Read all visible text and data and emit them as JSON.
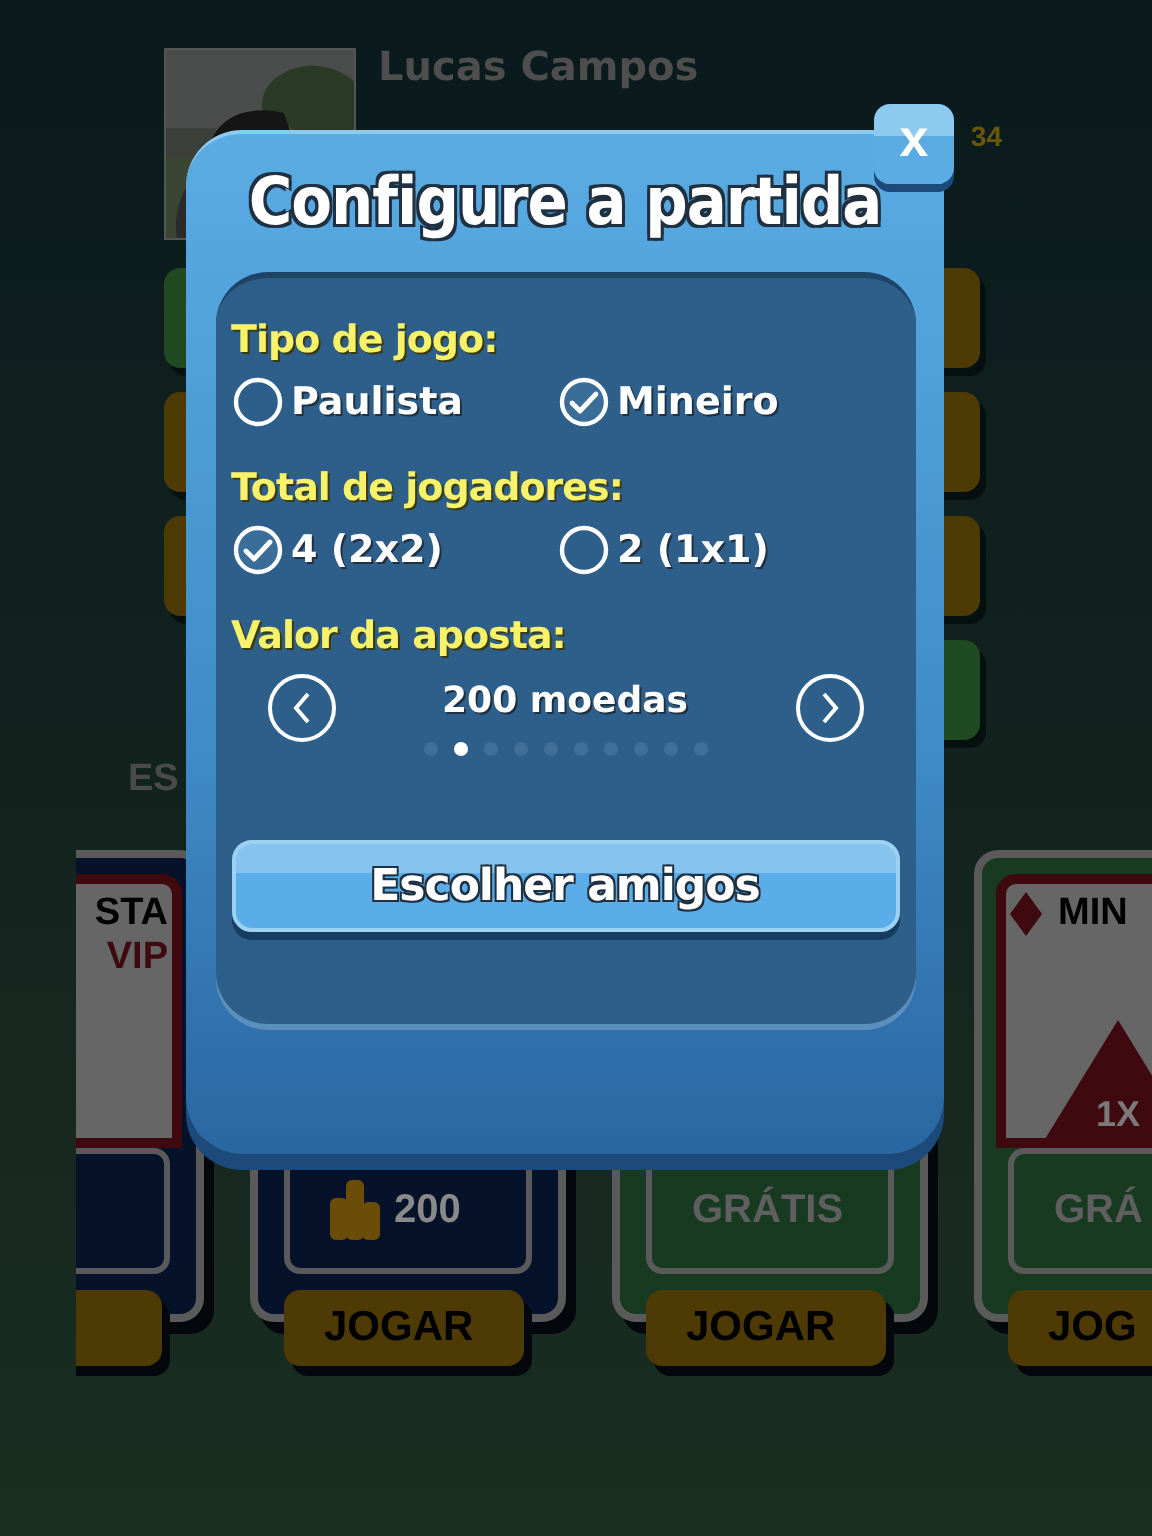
{
  "profile": {
    "name": "Lucas Campos",
    "coins": "34"
  },
  "section_heading": "ES",
  "side_tiles": {
    "left": [
      {
        "color": "#1f4a22"
      },
      {
        "color": "#4d3a05"
      },
      {
        "color": "#4d3a05"
      }
    ],
    "right": [
      {
        "color": "#4d3a05"
      },
      {
        "color": "#4d3a05"
      },
      {
        "color": "#4d3a05"
      },
      {
        "color": "#1f4a22"
      }
    ]
  },
  "cards": [
    {
      "kind": "vip",
      "title": "STA",
      "subtitle": "VIP",
      "color": "#06112a"
    },
    {
      "kind": "plain",
      "price": "200",
      "coins": true,
      "color": "#06112a",
      "button": "JOGAR"
    },
    {
      "kind": "plain",
      "price": "GRÁTIS",
      "coins": false,
      "color": "#173a20",
      "button": "JOGAR"
    },
    {
      "kind": "suit",
      "title": "MIN",
      "badge": "1X",
      "price": "GRÁ",
      "color": "#173a20",
      "button": "JOG"
    }
  ],
  "dialog": {
    "title": "Configure a partida",
    "close": "x",
    "groups": [
      {
        "label": "Tipo de jogo:",
        "options": [
          {
            "label": "Paulista",
            "selected": false
          },
          {
            "label": "Mineiro",
            "selected": true
          }
        ]
      },
      {
        "label": "Total de jogadores:",
        "options": [
          {
            "label": "4 (2x2)",
            "selected": true
          },
          {
            "label": "2 (1x1)",
            "selected": false
          }
        ]
      }
    ],
    "bet": {
      "label": "Valor da aposta:",
      "value": "200 moedas",
      "pages": [
        {
          "selected": false
        },
        {
          "selected": true
        },
        {
          "selected": false
        },
        {
          "selected": false
        },
        {
          "selected": false
        },
        {
          "selected": false
        },
        {
          "selected": false
        },
        {
          "selected": false
        },
        {
          "selected": false
        },
        {
          "selected": false
        }
      ]
    },
    "button": "Escolher amigos"
  }
}
